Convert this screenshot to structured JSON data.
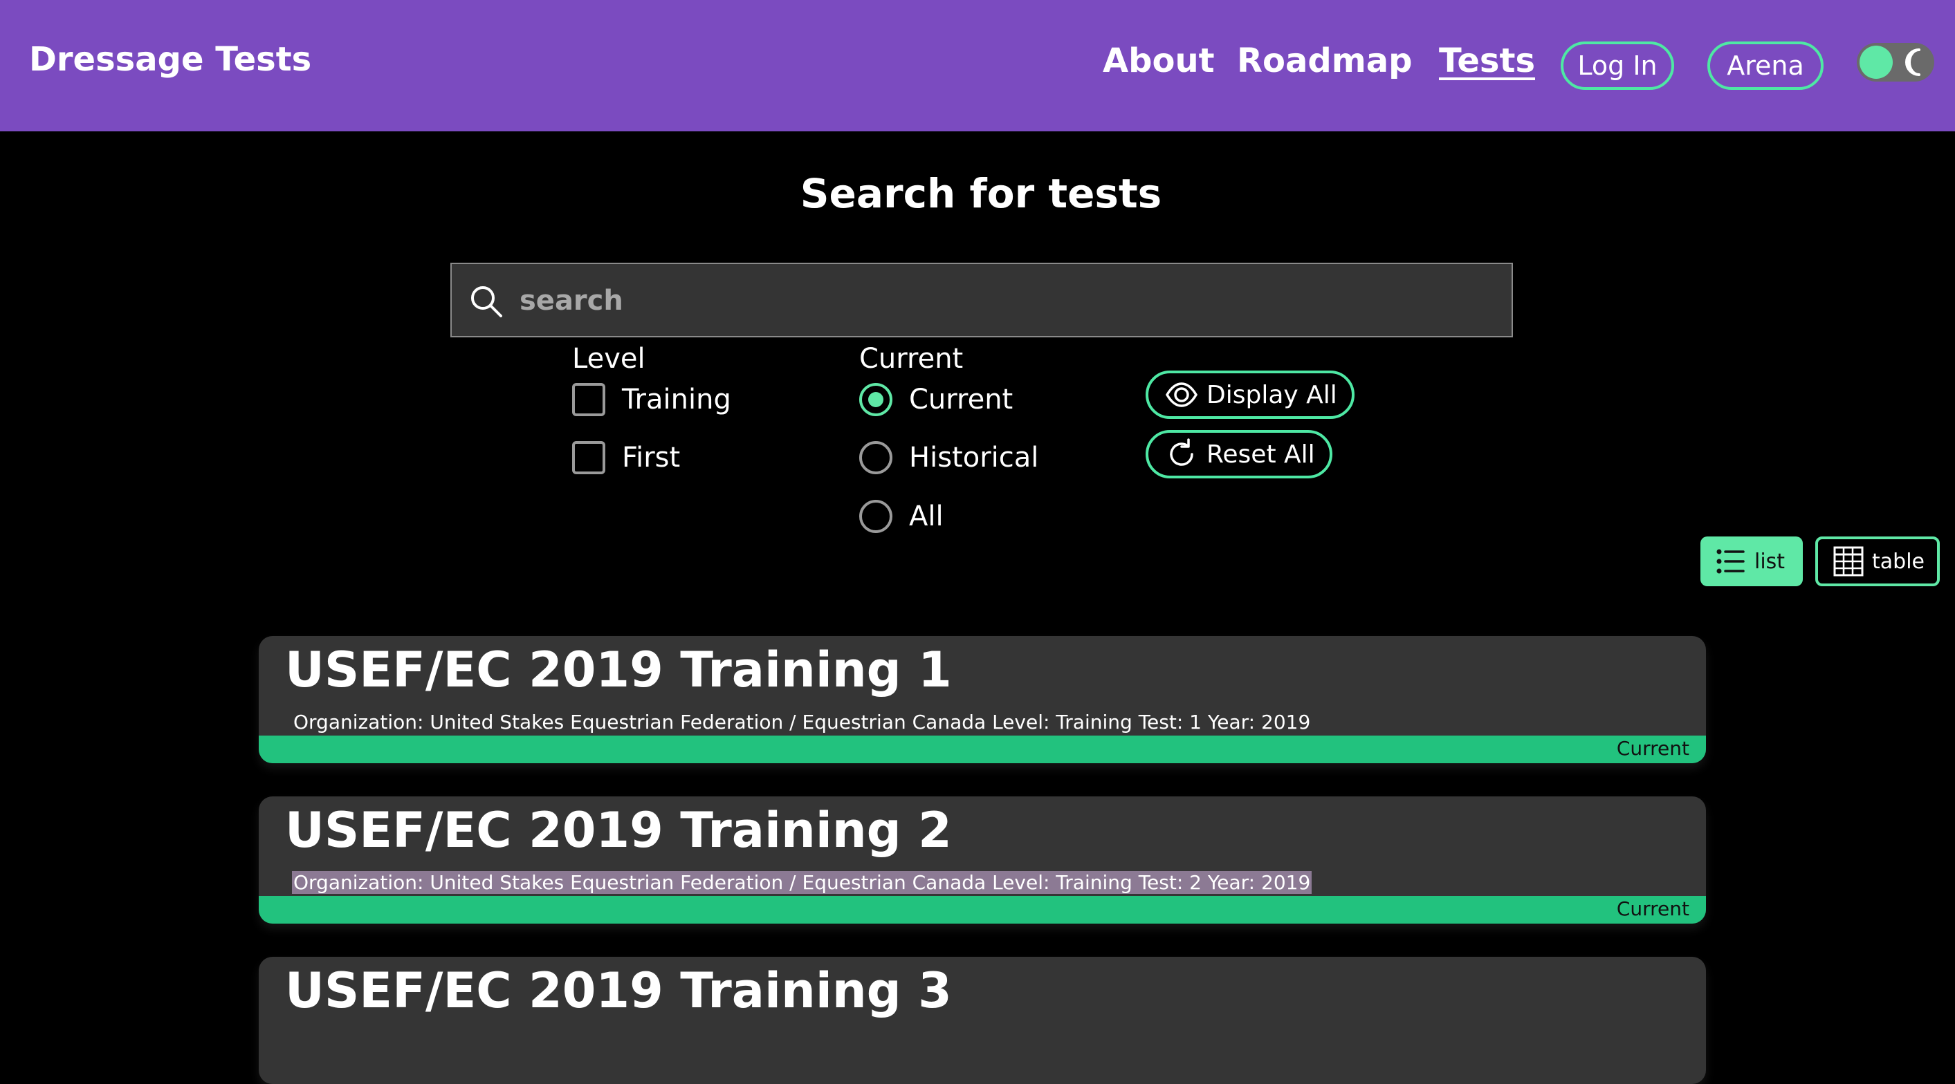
{
  "header": {
    "brand": "Dressage Tests",
    "nav": {
      "about": "About",
      "roadmap": "Roadmap",
      "tests": "Tests"
    },
    "login_label": "Log In",
    "arena_label": "Arena",
    "theme_toggle_icon": "moon-icon"
  },
  "search": {
    "title": "Search for tests",
    "placeholder": "search",
    "value": ""
  },
  "filters": {
    "level": {
      "heading": "Level",
      "options": [
        {
          "label": "Training",
          "checked": false
        },
        {
          "label": "First",
          "checked": false
        }
      ]
    },
    "current": {
      "heading": "Current",
      "options": [
        {
          "label": "Current",
          "checked": true
        },
        {
          "label": "Historical",
          "checked": false
        },
        {
          "label": "All",
          "checked": false
        }
      ]
    },
    "display_all_label": "Display All",
    "reset_all_label": "Reset All"
  },
  "view_toggle": {
    "list_label": "list",
    "table_label": "table",
    "active": "list"
  },
  "tests": [
    {
      "title": "USEF/EC 2019 Training 1",
      "meta": "Organization: United Stakes Equestrian Federation / Equestrian Canada Level: Training Test: 1 Year: 2019",
      "status": "Current"
    },
    {
      "title": "USEF/EC 2019 Training 2",
      "meta": "Organization: United Stakes Equestrian Federation / Equestrian Canada Level: Training Test: 2 Year: 2019",
      "status": "Current"
    },
    {
      "title": "USEF/EC 2019 Training 3",
      "meta": "",
      "status": ""
    }
  ],
  "colors": {
    "header_bg": "#7b4bc0",
    "accent": "#5fe8a6",
    "status_bar": "#22c27e",
    "card_bg": "#353535",
    "page_bg": "#000000"
  }
}
